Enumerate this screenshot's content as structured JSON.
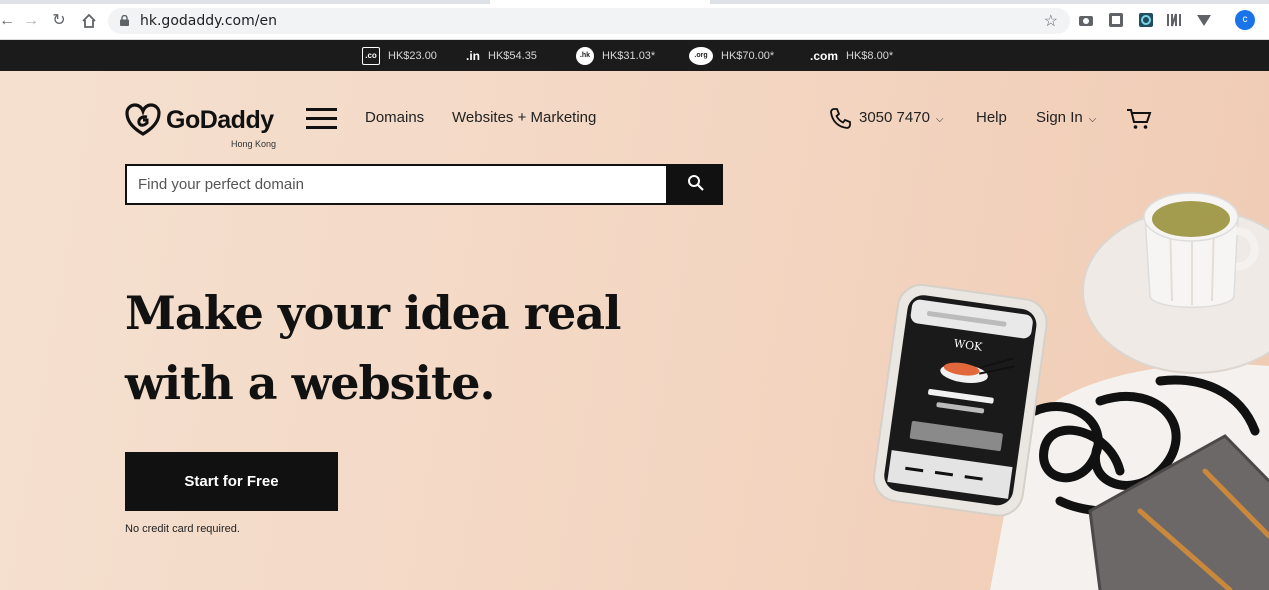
{
  "browser": {
    "url": "hk.godaddy.com/en",
    "profile_initial": "c"
  },
  "promo_bar": {
    "items": [
      {
        "tld": ".co",
        "price": "HK$23.00"
      },
      {
        "tld": ".in",
        "price": "HK$54.35"
      },
      {
        "tld": ".hk",
        "price": "HK$31.03*"
      },
      {
        "tld": ".org",
        "price": "HK$70.00*"
      },
      {
        "tld": ".com",
        "price": "HK$8.00*"
      }
    ]
  },
  "header": {
    "logo_text": "GoDaddy",
    "logo_region": "Hong Kong",
    "nav": {
      "domains": "Domains",
      "websites_marketing": "Websites + Marketing",
      "phone": "3050 7470",
      "help": "Help",
      "sign_in": "Sign In"
    }
  },
  "search": {
    "placeholder": "Find your perfect domain",
    "value": ""
  },
  "hero": {
    "headline_line1": "Make your idea real",
    "headline_line2": "with a website.",
    "cta_label": "Start for Free",
    "cta_note": "No credit card required.",
    "phone_screen_brand": "WOK"
  },
  "colors": {
    "hero_background": "#f3d6c2",
    "primary_dark": "#111111",
    "promo_bar_background": "#1b1b1b"
  }
}
